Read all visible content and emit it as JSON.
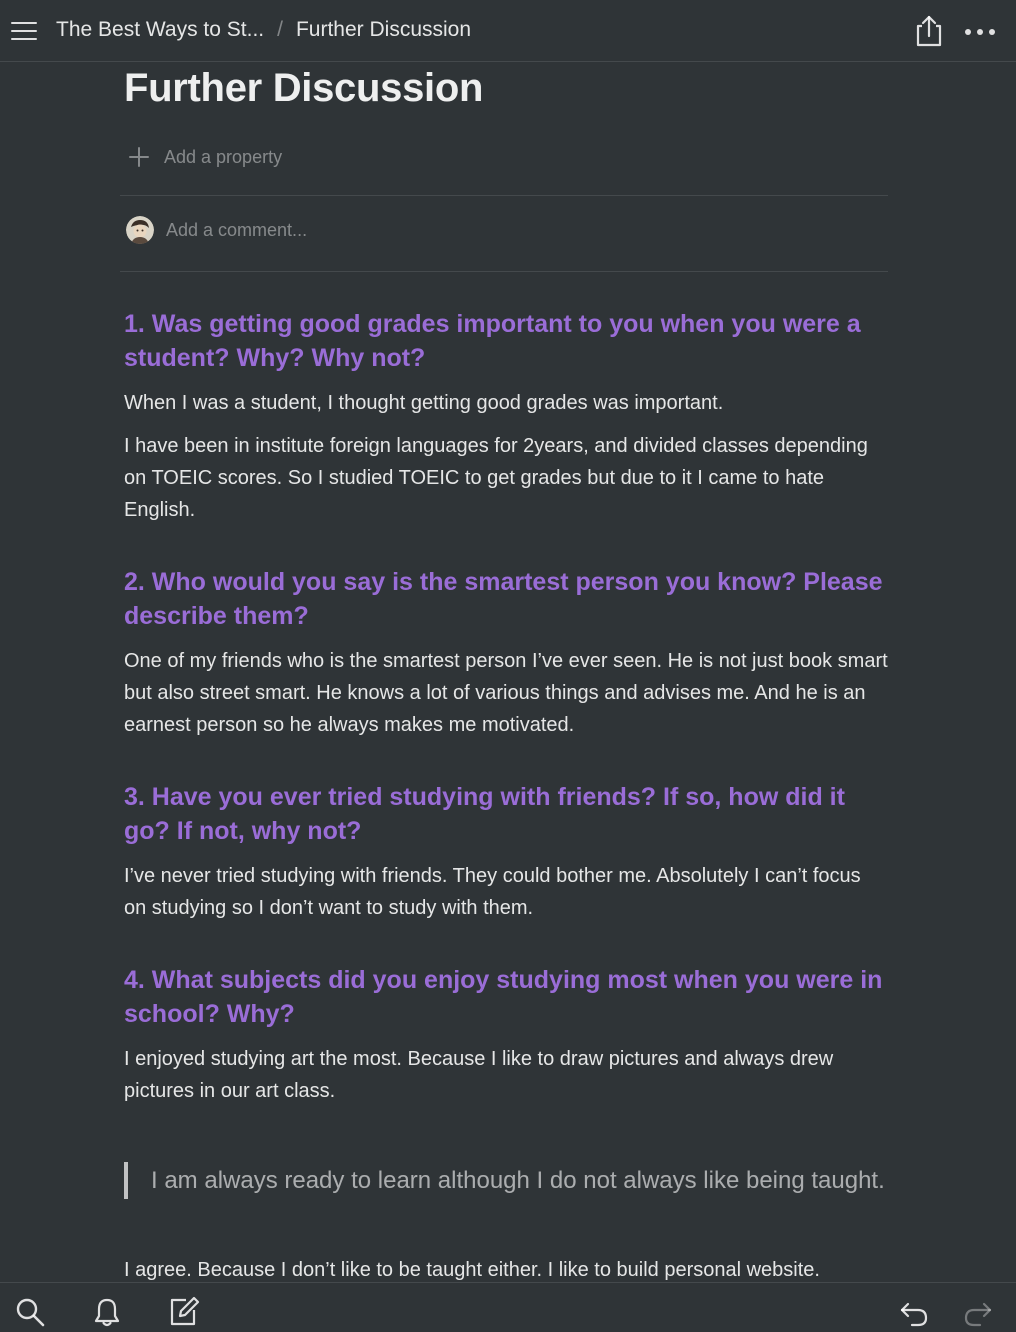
{
  "header": {
    "breadcrumb": [
      "The Best Ways to St...",
      "Further Discussion"
    ],
    "separator": "/"
  },
  "page": {
    "title": "Further Discussion",
    "add_property_label": "Add a property",
    "comment_placeholder": "Add a comment..."
  },
  "sections": [
    {
      "question": "1. Was getting good grades important to you when you were a student? Why? Why not?",
      "paragraphs": [
        "When I was a student, I thought getting good grades was important.",
        "I have been in institute foreign languages for 2years, and divided classes depending on TOEIC scores. So I studied TOEIC to get grades but due to it I came to hate English."
      ]
    },
    {
      "question": "2. Who would you say is the smartest person you know? Please describe them?",
      "paragraphs": [
        "One of my friends who is the smartest person I’ve ever seen. He is not just book smart but also street smart. He knows a lot of various things and advises me. And he is an earnest person so he always makes me motivated."
      ]
    },
    {
      "question": "3. Have you ever tried studying with friends? If so, how did it go? If not, why not?",
      "paragraphs": [
        "I’ve never tried studying with friends. They could bother me. Absolutely I can’t focus on studying so I don’t want to study with them."
      ]
    },
    {
      "question": "4. What subjects did you enjoy studying most when you were in school? Why?",
      "paragraphs": [
        "I enjoyed studying art the most. Because I like to draw pictures and always drew pictures in our art class."
      ]
    }
  ],
  "quote": {
    "text": "I am always ready to learn although I do not always like being taught.",
    "response": "I agree. Because I don’t like to be taught either. I like to build personal website."
  },
  "icons": {
    "menu": "hamburger-menu-icon",
    "share": "share-icon",
    "more": "more-horizontal-icon",
    "add": "plus-icon",
    "search": "search-icon",
    "notifications": "bell-icon",
    "new_page": "compose-icon",
    "undo": "undo-icon",
    "redo": "redo-icon"
  },
  "colors": {
    "background": "#2f3437",
    "heading_purple": "#9a6dd7",
    "text": "#e6e6e6",
    "muted": "#8a8d8f"
  }
}
